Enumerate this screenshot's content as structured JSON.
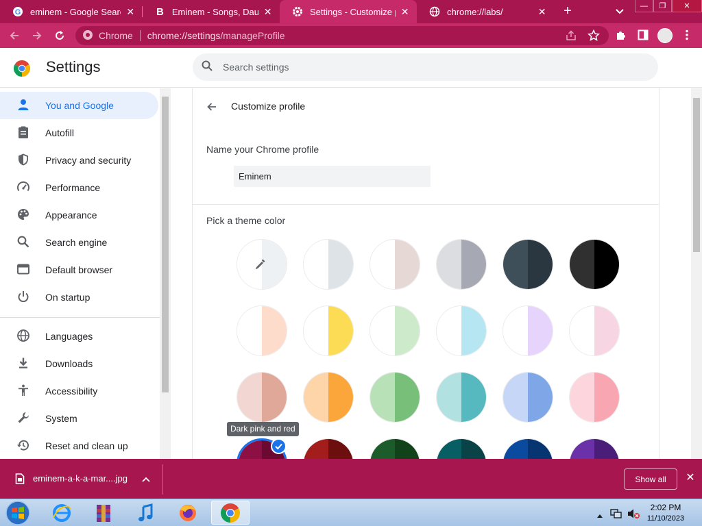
{
  "tabs": [
    {
      "title": "eminem - Google Search",
      "favicon": "google-icon"
    },
    {
      "title": "Eminem - Songs, Daughter",
      "favicon": "bing-b-icon"
    },
    {
      "title": "Settings - Customize profile",
      "favicon": "gear-icon"
    },
    {
      "title": "chrome://labs/",
      "favicon": "globe-icon"
    }
  ],
  "omnibox": {
    "site": "Chrome",
    "url_host": "chrome://settings",
    "url_path": "/manageProfile"
  },
  "settings": {
    "title": "Settings",
    "search_placeholder": "Search settings"
  },
  "sidebar": {
    "items": [
      {
        "label": "You and Google",
        "icon": "person-icon"
      },
      {
        "label": "Autofill",
        "icon": "clipboard-icon"
      },
      {
        "label": "Privacy and security",
        "icon": "shield-icon"
      },
      {
        "label": "Performance",
        "icon": "speedometer-icon"
      },
      {
        "label": "Appearance",
        "icon": "palette-icon"
      },
      {
        "label": "Search engine",
        "icon": "search-icon"
      },
      {
        "label": "Default browser",
        "icon": "browser-window-icon"
      },
      {
        "label": "On startup",
        "icon": "power-icon"
      },
      {
        "label": "Languages",
        "icon": "globe-icon"
      },
      {
        "label": "Downloads",
        "icon": "download-icon"
      },
      {
        "label": "Accessibility",
        "icon": "accessibility-icon"
      },
      {
        "label": "System",
        "icon": "wrench-icon"
      },
      {
        "label": "Reset and clean up",
        "icon": "restore-icon"
      }
    ]
  },
  "profile": {
    "title": "Customize profile",
    "name_label": "Name your Chrome profile",
    "name_value": "Eminem",
    "theme_label": "Pick a theme color",
    "tooltip": "Dark pink and red"
  },
  "theme_colors": [
    [
      "#ffffff",
      "#eef1f3"
    ],
    [
      "#ffffff",
      "#dee3e8"
    ],
    [
      "#ffffff",
      "#e6d8d5"
    ],
    [
      "#dcdde1",
      "#a6a9b3"
    ],
    [
      "#3f4f5a",
      "#2a3640"
    ],
    [
      "#303030",
      "#000000"
    ],
    [
      "#ffffff",
      "#fddccb"
    ],
    [
      "#ffffff",
      "#fddc55"
    ],
    [
      "#ffffff",
      "#cdeacb"
    ],
    [
      "#ffffff",
      "#b6e6f2"
    ],
    [
      "#ffffff",
      "#e6d4fc"
    ],
    [
      "#ffffff",
      "#f8d5e2"
    ],
    [
      "#f2d6d2",
      "#e0a898"
    ],
    [
      "#fed5a9",
      "#fba63a"
    ],
    [
      "#b9e1b8",
      "#78bf79"
    ],
    [
      "#b1e1e0",
      "#55b9bf"
    ],
    [
      "#c5d6f6",
      "#7fa7e8"
    ],
    [
      "#fdd6dd",
      "#f9a6b3"
    ],
    [
      "#8c1043",
      "#6a0a33"
    ],
    [
      "#a31d1d",
      "#6e0f0f"
    ],
    [
      "#1c5c2a",
      "#114219"
    ],
    [
      "#075e63",
      "#0a4347"
    ],
    [
      "#0a4ba0",
      "#073572"
    ],
    [
      "#6b31a8",
      "#4a1e78"
    ]
  ],
  "downloads": {
    "filename": "eminem-a-k-a-mar....jpg",
    "show_all": "Show all"
  },
  "taskbar": {
    "time": "2:02 PM",
    "date": "11/10/2023"
  },
  "colors": {
    "accent": "#1a73e8",
    "tab_strip": "#a8164f",
    "toolbar": "#c62a68"
  }
}
